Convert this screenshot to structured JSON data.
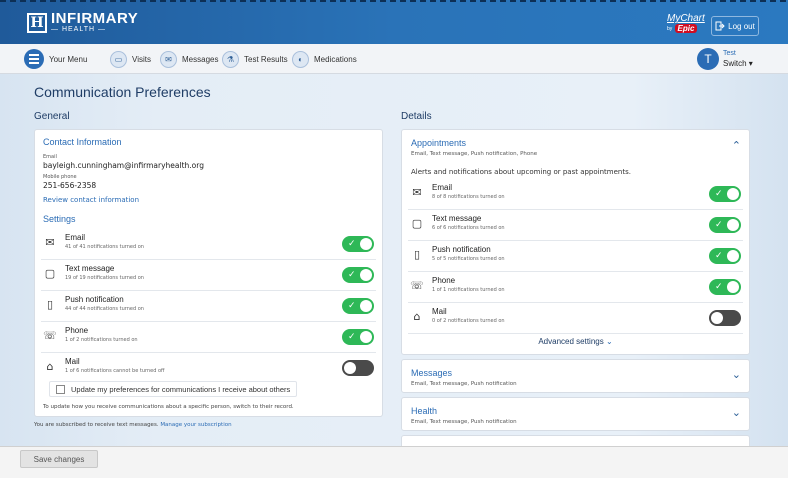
{
  "header": {
    "logo_mark": "H",
    "logo_name": "INFIRMARY",
    "logo_sub": "— HEALTH —",
    "mychart": "MyChart",
    "mychart_by": "by",
    "epic": "Epic",
    "logout_label": "Log out"
  },
  "nav": {
    "menu_label": "Your Menu",
    "items": [
      {
        "label": "Visits",
        "icon": "calendar-icon"
      },
      {
        "label": "Messages",
        "icon": "envelope-icon"
      },
      {
        "label": "Test Results",
        "icon": "flask-icon"
      },
      {
        "label": "Medications",
        "icon": "pill-icon"
      }
    ],
    "user_initial": "T",
    "user_name": "Test",
    "switch_label": "Switch"
  },
  "page": {
    "title": "Communication Preferences",
    "general_title": "General",
    "details_title": "Details"
  },
  "contact": {
    "title": "Contact Information",
    "email_label": "Email",
    "email": "bayleigh.cunningham@infirmaryhealth.org",
    "phone_label": "Mobile phone",
    "phone": "251-656-2358",
    "review_link": "Review contact information"
  },
  "settings": {
    "title": "Settings",
    "rows": [
      {
        "icon": "envelope-icon",
        "title": "Email",
        "sub": "41 of 41 notifications turned on",
        "on": true
      },
      {
        "icon": "chat-bubble-icon",
        "title": "Text message",
        "sub": "19 of 19 notifications turned on",
        "on": true
      },
      {
        "icon": "mobile-phone-icon",
        "title": "Push notification",
        "sub": "44 of 44 notifications turned on",
        "on": true
      },
      {
        "icon": "phone-handset-icon",
        "title": "Phone",
        "sub": "1 of 2 notifications turned on",
        "on": true
      },
      {
        "icon": "mailbox-icon",
        "title": "Mail",
        "sub": "1 of 6 notifications cannot be turned off",
        "on": false
      }
    ],
    "others_checkbox": "Update my preferences for communications I receive about others",
    "others_note": "To update how you receive communications about a specific person, switch to their record.",
    "subscribed_text": "You are subscribed to receive text messages.",
    "subscription_link": "Manage your subscription"
  },
  "details": {
    "appointments": {
      "title": "Appointments",
      "sub": "Email, Text message, Push notification, Phone",
      "desc": "Alerts and notifications about upcoming or past appointments.",
      "rows": [
        {
          "icon": "envelope-icon",
          "title": "Email",
          "sub": "8 of 8 notifications turned on",
          "on": true
        },
        {
          "icon": "chat-bubble-icon",
          "title": "Text message",
          "sub": "6 of 6 notifications turned on",
          "on": true
        },
        {
          "icon": "mobile-phone-icon",
          "title": "Push notification",
          "sub": "5 of 5 notifications turned on",
          "on": true
        },
        {
          "icon": "phone-handset-icon",
          "title": "Phone",
          "sub": "1 of 1 notifications turned on",
          "on": true
        },
        {
          "icon": "mailbox-icon",
          "title": "Mail",
          "sub": "0 of 2 notifications turned on",
          "on": false
        }
      ],
      "advanced": "Advanced settings"
    },
    "messages": {
      "title": "Messages",
      "sub": "Email, Text message, Push notification"
    },
    "health": {
      "title": "Health",
      "sub": "Email, Text message, Push notification"
    }
  },
  "footer": {
    "save_label": "Save changes"
  }
}
